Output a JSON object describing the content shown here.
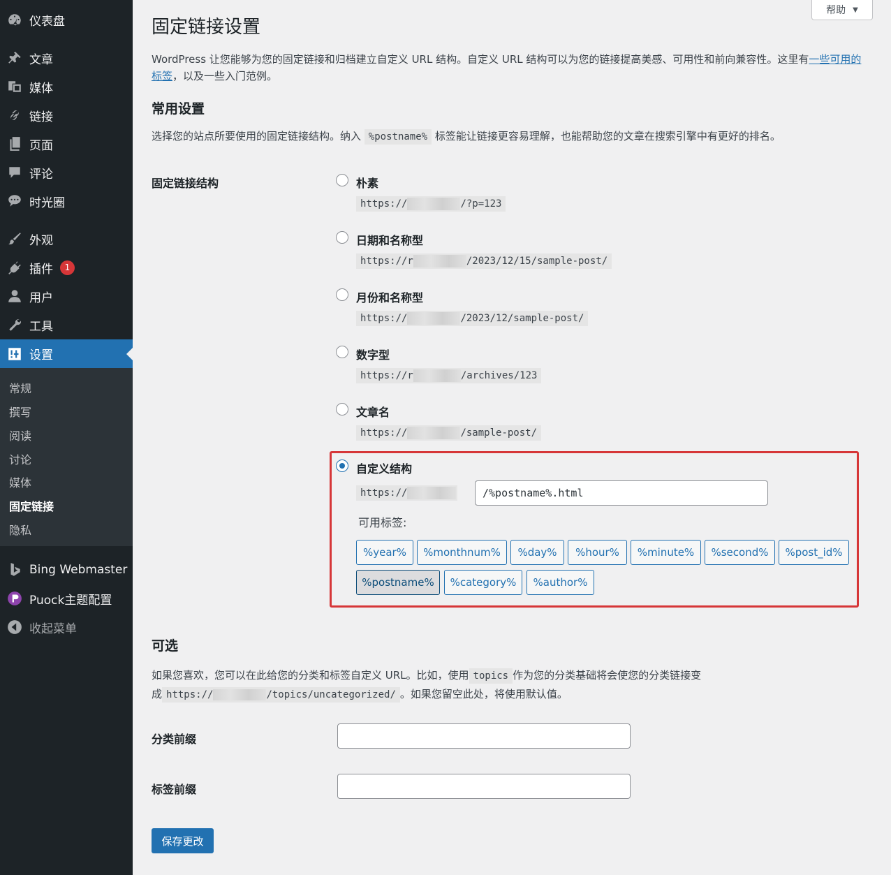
{
  "sidebar": {
    "items": [
      {
        "label": "仪表盘",
        "icon": "dashboard-icon"
      },
      {
        "label": "文章",
        "icon": "pin-icon"
      },
      {
        "label": "媒体",
        "icon": "media-icon"
      },
      {
        "label": "链接",
        "icon": "link-icon"
      },
      {
        "label": "页面",
        "icon": "page-icon"
      },
      {
        "label": "评论",
        "icon": "comment-icon"
      },
      {
        "label": "时光圈",
        "icon": "chat-bubbles-icon"
      },
      {
        "label": "外观",
        "icon": "brush-icon"
      },
      {
        "label": "插件",
        "icon": "plugin-icon",
        "badge": "1"
      },
      {
        "label": "用户",
        "icon": "user-icon"
      },
      {
        "label": "工具",
        "icon": "wrench-icon"
      },
      {
        "label": "设置",
        "icon": "settings-icon"
      },
      {
        "label": "Bing Webmaster",
        "icon": "bing-icon"
      },
      {
        "label": "Puock主题配置",
        "icon": "puock-icon"
      },
      {
        "label": "收起菜单",
        "icon": "collapse-icon"
      }
    ],
    "submenu": [
      "常规",
      "撰写",
      "阅读",
      "讨论",
      "媒体",
      "固定链接",
      "隐私"
    ]
  },
  "help": {
    "label": "帮助"
  },
  "page": {
    "title": "固定链接设置",
    "intro_text": "WordPress 让您能够为您的固定链接和归档建立自定义 URL 结构。自定义 URL 结构可以为您的链接提高美感、可用性和前向兼容性。这里有",
    "intro_link": "一些可用的标签",
    "intro_tail": "，以及一些入门范例。"
  },
  "common": {
    "heading": "常用设置",
    "desc_pre": "选择您的站点所要使用的固定链接结构。纳入",
    "desc_code": "%postname%",
    "desc_post": "标签能让链接更容易理解，也能帮助您的文章在搜索引擎中有更好的排名。",
    "row_label": "固定链接结构"
  },
  "options": [
    {
      "label": "朴素",
      "prefix": "https://",
      "suffix": "/?p=123"
    },
    {
      "label": "日期和名称型",
      "prefix": "https://r",
      "suffix": "/2023/12/15/sample-post/"
    },
    {
      "label": "月份和名称型",
      "prefix": "https://",
      "suffix": "/2023/12/sample-post/"
    },
    {
      "label": "数字型",
      "prefix": "https://r",
      "suffix": "/archives/123"
    },
    {
      "label": "文章名",
      "prefix": "https://",
      "suffix": "/sample-post/"
    }
  ],
  "custom": {
    "label": "自定义结构",
    "prefix": "https://",
    "value": "/%postname%.html",
    "tags_label": "可用标签:",
    "tags": [
      "%year%",
      "%monthnum%",
      "%day%",
      "%hour%",
      "%minute%",
      "%second%",
      "%post_id%",
      "%postname%",
      "%category%",
      "%author%"
    ]
  },
  "optional": {
    "heading": "可选",
    "desc1_pre": "如果您喜欢，您可以在此给您的分类和标签自定义 URL。比如，使用",
    "desc1_code": "topics",
    "desc1_post": "作为您的分类基础将会使您的分类链接变",
    "desc2_pre": "成",
    "desc2_code_prefix": "https://",
    "desc2_code_suffix": "/topics/uncategorized/",
    "desc2_post": "。如果您留空此处，将使用默认值。",
    "category_label": "分类前缀",
    "tag_label": "标签前缀"
  },
  "save_label": "保存更改",
  "colors": {
    "accent": "#2271b1",
    "sidebar": "#1d2327",
    "highlight": "#d63638"
  }
}
